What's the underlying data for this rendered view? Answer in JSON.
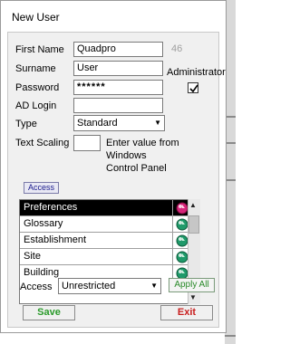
{
  "window": {
    "title": "New User"
  },
  "form": {
    "first_name_label": "First Name",
    "first_name_value": "Quadpro",
    "char_count": "46",
    "surname_label": "Surname",
    "surname_value": "User",
    "administrator_label": "Administrator",
    "administrator_checked": true,
    "password_label": "Password",
    "password_value": "******",
    "ad_login_label": "AD Login",
    "ad_login_value": "",
    "type_label": "Type",
    "type_value": "Standard",
    "text_scaling_label": "Text Scaling",
    "text_scaling_value": "",
    "text_scaling_hint_line1": "Enter value from Windows",
    "text_scaling_hint_line2": "Control Panel"
  },
  "access_tab": {
    "label": "Access"
  },
  "access_list": {
    "items": [
      {
        "label": "Preferences",
        "icon": "red-access-icon",
        "selected": true
      },
      {
        "label": "Glossary",
        "icon": "green-access-icon",
        "selected": false
      },
      {
        "label": "Establishment",
        "icon": "green-access-icon",
        "selected": false
      },
      {
        "label": "Site",
        "icon": "green-access-icon",
        "selected": false
      },
      {
        "label": "Building",
        "icon": "green-access-icon",
        "selected": false
      }
    ]
  },
  "access_control": {
    "label": "Access",
    "value": "Unrestricted",
    "apply_all_label": "Apply All"
  },
  "buttons": {
    "save_label": "Save",
    "exit_label": "Exit"
  },
  "colors": {
    "save": "#2a9a2a",
    "exit": "#c81e1e",
    "selected_row_bg": "#000000",
    "access_tab_text": "#1a1a8c"
  }
}
